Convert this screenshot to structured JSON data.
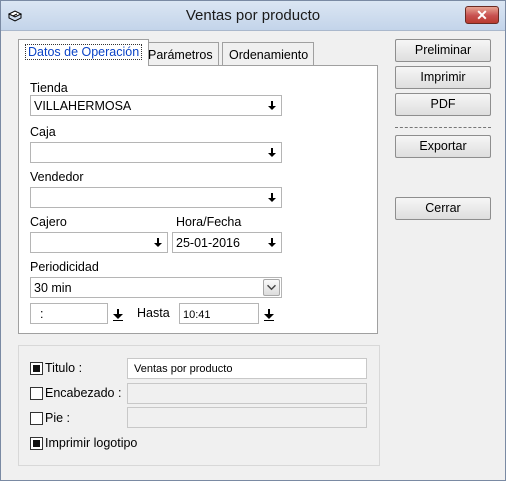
{
  "window": {
    "title": "Ventas por producto"
  },
  "tabs": [
    {
      "label": "Datos de Operación"
    },
    {
      "label": "Parámetros"
    },
    {
      "label": "Ordenamiento"
    }
  ],
  "form": {
    "tienda_label": "Tienda",
    "tienda_value": "VILLAHERMOSA",
    "caja_label": "Caja",
    "caja_value": "",
    "vendedor_label": "Vendedor",
    "vendedor_value": "",
    "cajero_label": "Cajero",
    "cajero_value": "",
    "horafecha_label": "Hora/Fecha",
    "horafecha_value": "25-01-2016",
    "periodicidad_label": "Periodicidad",
    "periodicidad_value": "30 min",
    "desde_value": ":",
    "hasta_label": "Hasta",
    "hasta_value": "10:41"
  },
  "buttons": {
    "preliminar": "Preliminar",
    "imprimir": "Imprimir",
    "pdf": "PDF",
    "exportar": "Exportar",
    "cerrar": "Cerrar"
  },
  "options": {
    "titulo_label": "Titulo :",
    "titulo_checked": true,
    "titulo_value": "Ventas por producto",
    "encabezado_label": "Encabezado :",
    "encabezado_checked": false,
    "encabezado_value": "",
    "pie_label": "Pie :",
    "pie_checked": false,
    "pie_value": "",
    "logotipo_label": "Imprimir logotipo",
    "logotipo_checked": true
  }
}
